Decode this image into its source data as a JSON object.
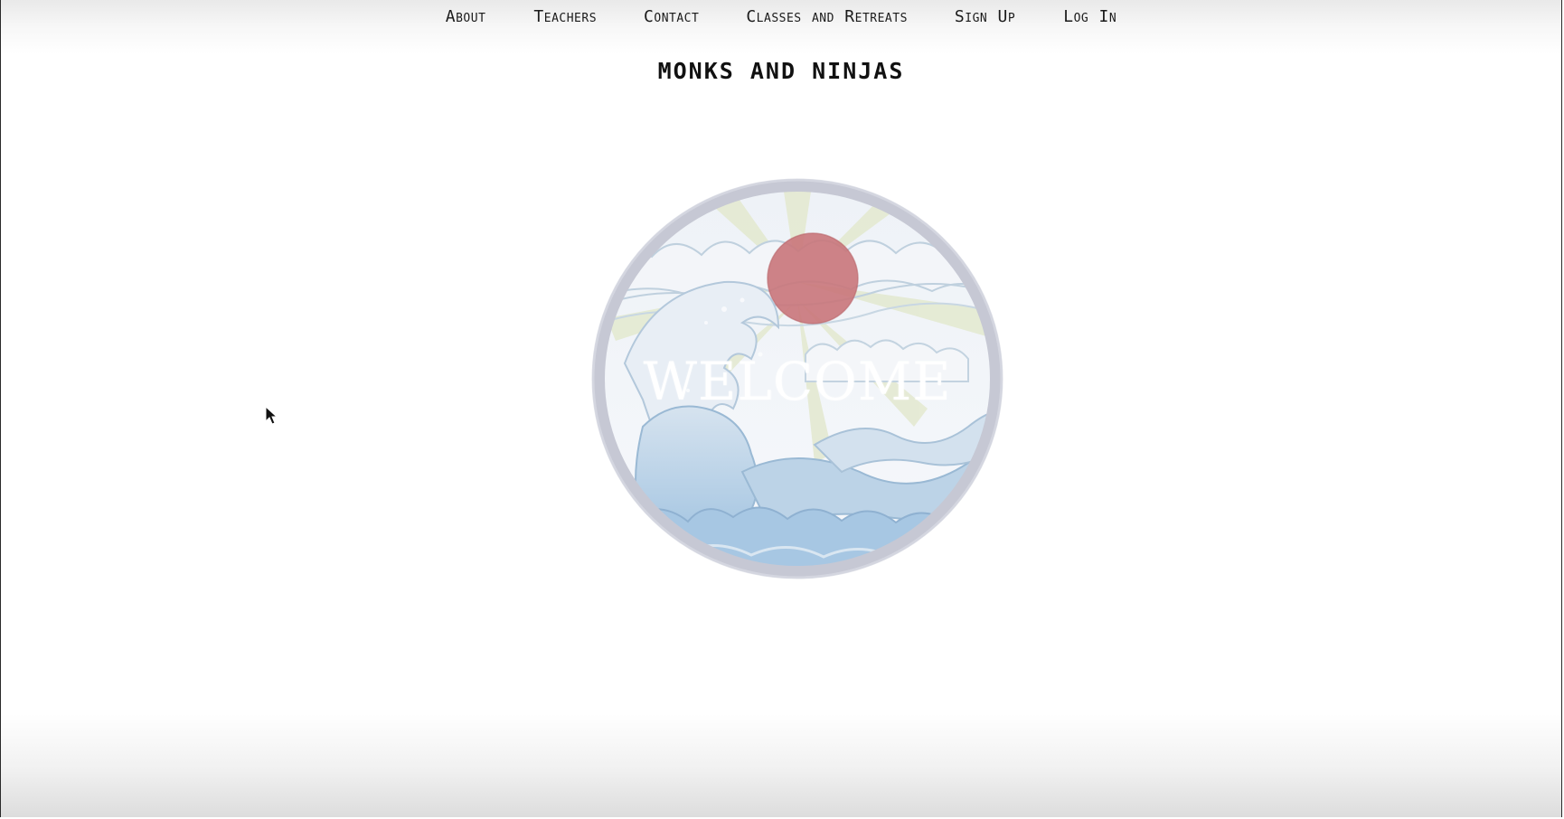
{
  "nav": {
    "items": [
      {
        "label": "About"
      },
      {
        "label": "Teachers"
      },
      {
        "label": "Contact"
      },
      {
        "label": "Classes and Retreats"
      },
      {
        "label": "Sign Up"
      },
      {
        "label": "Log In"
      }
    ]
  },
  "site": {
    "title": "MONKS AND NINJAS"
  },
  "hero": {
    "welcome_text": "WELCOME",
    "image_icon": "wave-sun-emblem-icon"
  },
  "colors": {
    "sun": "#c9767a",
    "wave": "#a9c6e0",
    "rim": "#c7c9d6",
    "rays": "#dfe6c8"
  }
}
